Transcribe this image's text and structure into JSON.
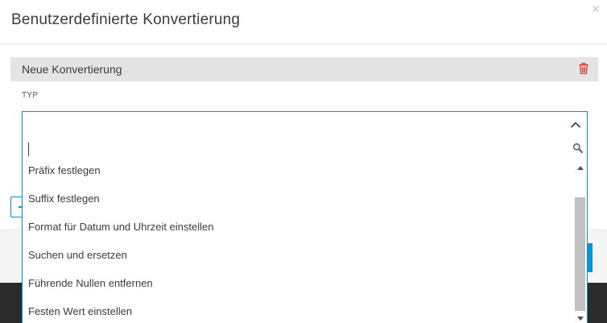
{
  "dialog": {
    "title": "Benutzerdefinierte Konvertierung",
    "close_icon": "close-icon"
  },
  "conversion": {
    "name": "Neue Konvertierung",
    "delete_icon": "trash-icon",
    "delete_color": "#d9302c"
  },
  "type_field": {
    "label": "TYP",
    "value": "",
    "search_value": "",
    "search_placeholder": "",
    "accent_color": "#0696d7",
    "options": [
      "Präfix festlegen",
      "Suffix festlegen",
      "Format für Datum und Uhrzeit einstellen",
      "Suchen und ersetzen",
      "Führende Nullen entfernen",
      "Festen Wert einstellen"
    ]
  }
}
